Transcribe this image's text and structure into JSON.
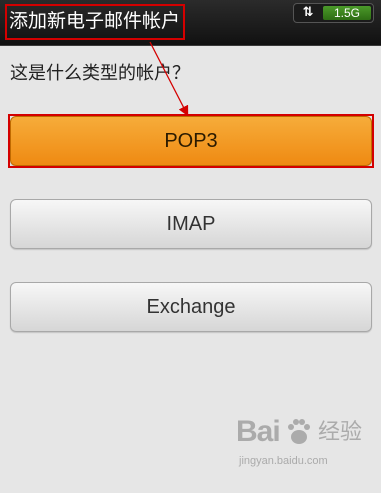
{
  "titlebar": {
    "title": "添加新电子邮件帐户"
  },
  "status": {
    "data_icon": "up-down-arrows-icon",
    "data_icon_glyph": "⇅",
    "data_usage": "1.5G"
  },
  "main": {
    "question": "这是什么类型的帐户？",
    "options": [
      {
        "label": "POP3",
        "selected": true
      },
      {
        "label": "IMAP",
        "selected": false
      },
      {
        "label": "Exchange",
        "selected": false
      }
    ]
  },
  "watermark": {
    "logo_prefix": "Bai",
    "logo_suffix": "经验",
    "url": "jingyan.baidu.com"
  },
  "colors": {
    "highlight": "#d40000",
    "selected_button": "#f39a1f",
    "titlebar": "#1a1a1a",
    "background": "#e6e6e6"
  }
}
